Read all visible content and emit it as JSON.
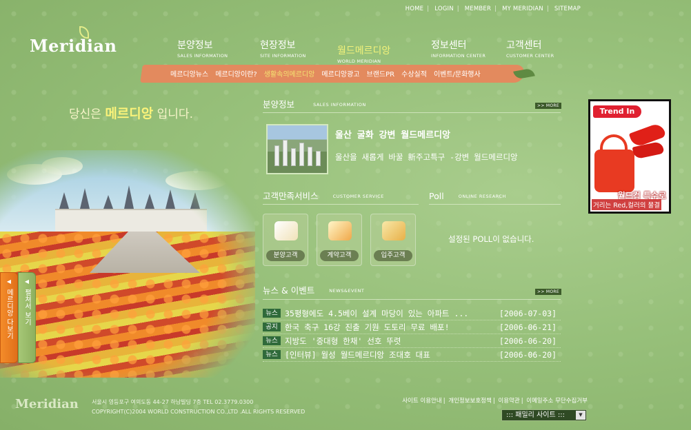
{
  "util_nav": [
    {
      "label": "HOME"
    },
    {
      "label": "LOGIN"
    },
    {
      "label": "MEMBER"
    },
    {
      "label": "MY MERIDIAN"
    },
    {
      "label": "SITEMAP"
    }
  ],
  "logo": {
    "text": "Meridian"
  },
  "gnb": [
    {
      "ko": "분양정보",
      "en": "SALES INFORMATION"
    },
    {
      "ko": "현장정보",
      "en": "SITE INFORMATION"
    },
    {
      "ko": "월드메르디앙",
      "en": "WORLD MERIDIAN"
    },
    {
      "ko": "정보센터",
      "en": "INFORMATION CENTER"
    },
    {
      "ko": "고객센터",
      "en": "CUSTOMER CENTER"
    }
  ],
  "sub_menu": [
    {
      "label": "메르디앙뉴스"
    },
    {
      "label": "메르디앙이란?"
    },
    {
      "label": "생활속의메르디앙"
    },
    {
      "label": "메르디앙광고"
    },
    {
      "label": "브랜드PR"
    },
    {
      "label": "수상실적"
    },
    {
      "label": "이벤트/문화행사"
    }
  ],
  "slogan": {
    "pre": "당신은 ",
    "brand": "메르디앙",
    "post": " 입니다."
  },
  "side_tabs": {
    "orange": "메르디앙 다보기",
    "green": "펼쳐서 보기"
  },
  "sales": {
    "heading_ko": "분양정보",
    "heading_en": "SALES INFORMATION",
    "more": ">> MORE",
    "title": "울산 굴화 강변 월드메르디앙",
    "desc": "울산을 새롭게 바꿀 新주고특구 -강변 월드메르디앙"
  },
  "customer_service": {
    "heading_ko": "고객만족서비스",
    "heading_en": "CUSTOMER SERVICE",
    "items": [
      {
        "label": "분양고객"
      },
      {
        "label": "계약고객"
      },
      {
        "label": "입주고객"
      }
    ]
  },
  "poll": {
    "heading_ko": "Poll",
    "heading_en": "ONLINE RESEARCH",
    "message": "설정된 POLL이 없습니다."
  },
  "news": {
    "heading_ko": "뉴스 & 이벤트",
    "heading_en": "NEWS&EVENT",
    "more": ">> MORE",
    "rows": [
      {
        "badge": "뉴스",
        "title": "35평형에도 4.5베이 설계 마당이 있는 아파트 ...",
        "date": "[2006-07-03]"
      },
      {
        "badge": "공지",
        "title": "한국 축구 16강 진출 기원 도토리 무료 배포!",
        "date": "[2006-06-21]"
      },
      {
        "badge": "뉴스",
        "title": "지방도 '중대형 한채' 선호 뚜렷",
        "date": "[2006-06-20]"
      },
      {
        "badge": "뉴스",
        "title": "[인터뷰] 월성 월드메르디앙 조대호 대표",
        "date": "[2006-06-20]"
      }
    ]
  },
  "banner": {
    "tag": "Trend In",
    "headline": "월드컵 특수로",
    "sub": "거리는 Red,컬러의 물결"
  },
  "footer": {
    "logo": "Meridian",
    "address": "서울시 영등포구 여의도동 44-27 하남빌딩 7층 TEL 02.3779.0300",
    "copyright": "COPYRIGHT(C)2004 WORLD CONSTRUCTION CO.,LTD .ALL RIGHTS RESERVED",
    "links": [
      {
        "label": "사이트 이용안내"
      },
      {
        "label": "개인정보보호정책"
      },
      {
        "label": "이용약관"
      },
      {
        "label": "이메일주소 무단수집거부"
      }
    ],
    "family_site": "::: 패밀리 사이트 :::"
  },
  "colors": {
    "accent_orange": "#e38a5e",
    "news_badge": "#2f6a3a",
    "banner_red": "#e02030"
  }
}
